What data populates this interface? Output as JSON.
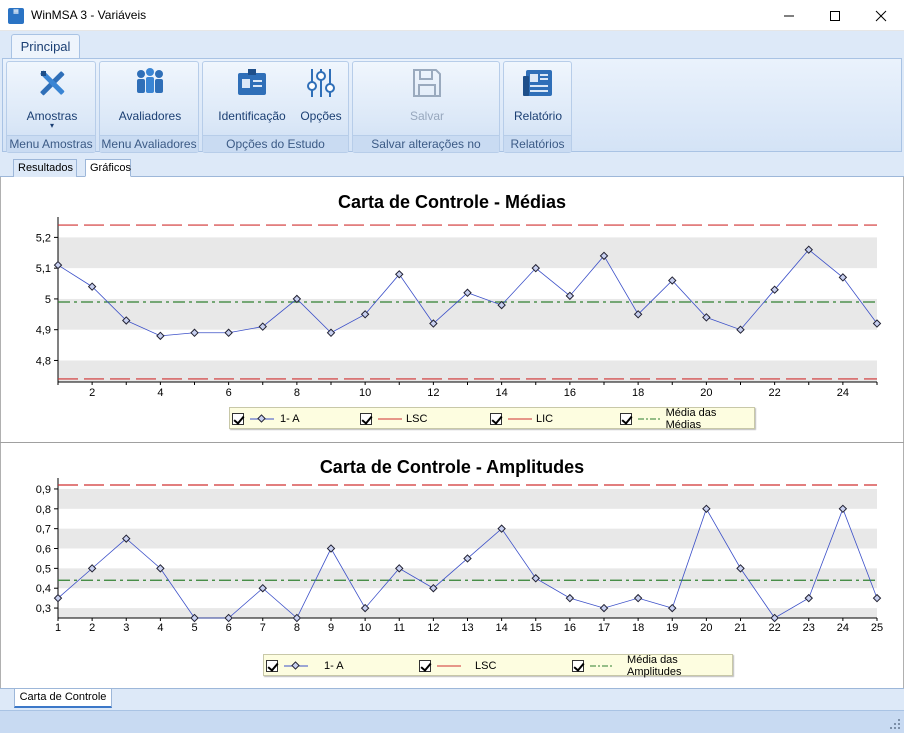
{
  "window": {
    "title": "WinMSA 3 - Variáveis",
    "icon": "app-icon"
  },
  "ribbon": {
    "tab": "Principal",
    "groups": [
      {
        "label": "Menu Amostras",
        "buttons": [
          {
            "label": "Amostras",
            "icon": "tools-icon"
          }
        ]
      },
      {
        "label": "Menu Avaliadores",
        "buttons": [
          {
            "label": "Avaliadores",
            "icon": "users-icon"
          }
        ]
      },
      {
        "label": "Opções do Estudo",
        "buttons": [
          {
            "label": "Identificação",
            "icon": "id-card-icon"
          },
          {
            "label": "Opções",
            "icon": "sliders-icon"
          }
        ]
      },
      {
        "label": "Salvar alterações no Estudo",
        "buttons": [
          {
            "label": "Salvar",
            "icon": "save-icon",
            "disabled": true
          }
        ]
      },
      {
        "label": "Relatórios",
        "buttons": [
          {
            "label": "Relatório",
            "icon": "report-icon"
          }
        ]
      }
    ]
  },
  "subtabs": {
    "results": "Resultados",
    "graphs": "Gráficos"
  },
  "bottom_tab": "Carta de Controle",
  "colors": {
    "series": "#3c50c8",
    "limit": "#d03030",
    "center": "#308030",
    "band": "#e8e8e8"
  },
  "chart_data": [
    {
      "type": "line",
      "title": "Carta de Controle - Médias",
      "x": [
        1,
        2,
        3,
        4,
        5,
        6,
        7,
        8,
        9,
        10,
        11,
        12,
        13,
        14,
        15,
        16,
        17,
        18,
        19,
        20,
        21,
        22,
        23,
        24,
        25
      ],
      "x_tick_labels": [
        "2",
        "4",
        "6",
        "8",
        "10",
        "12",
        "14",
        "16",
        "18",
        "20",
        "22",
        "24"
      ],
      "y_tick_labels": [
        "4,8",
        "4,9",
        "5",
        "5,1",
        "5,2"
      ],
      "ylim": [
        4.73,
        5.25
      ],
      "series": [
        {
          "name": "1- A",
          "values": [
            5.11,
            5.04,
            4.93,
            4.88,
            4.89,
            4.89,
            4.91,
            5.0,
            4.89,
            4.95,
            5.08,
            4.92,
            5.02,
            4.98,
            5.1,
            5.01,
            5.14,
            4.95,
            5.06,
            4.94,
            4.9,
            5.03,
            5.16,
            5.07,
            4.92
          ]
        }
      ],
      "lines": [
        {
          "name": "LSC",
          "value": 5.24,
          "style": "dashed"
        },
        {
          "name": "LIC",
          "value": 4.74,
          "style": "dashed"
        },
        {
          "name": "Média das Médias",
          "value": 4.99,
          "style": "dashdot"
        }
      ],
      "legend": [
        "1- A",
        "LSC",
        "LIC",
        "Média das Médias"
      ],
      "grid": "alternating horizontal bands"
    },
    {
      "type": "line",
      "title": "Carta de Controle - Amplitudes",
      "x": [
        1,
        2,
        3,
        4,
        5,
        6,
        7,
        8,
        9,
        10,
        11,
        12,
        13,
        14,
        15,
        16,
        17,
        18,
        19,
        20,
        21,
        22,
        23,
        24,
        25
      ],
      "x_tick_labels": [
        "1",
        "2",
        "3",
        "4",
        "5",
        "6",
        "7",
        "8",
        "9",
        "10",
        "11",
        "12",
        "13",
        "14",
        "15",
        "16",
        "17",
        "18",
        "19",
        "20",
        "21",
        "22",
        "23",
        "24",
        "25"
      ],
      "y_tick_labels": [
        "0,3",
        "0,4",
        "0,5",
        "0,6",
        "0,7",
        "0,8",
        "0,9"
      ],
      "ylim": [
        0.25,
        0.93
      ],
      "series": [
        {
          "name": "1- A",
          "values": [
            0.35,
            0.5,
            0.65,
            0.5,
            0.25,
            0.25,
            0.4,
            0.25,
            0.6,
            0.3,
            0.5,
            0.4,
            0.55,
            0.7,
            0.45,
            0.35,
            0.3,
            0.35,
            0.3,
            0.8,
            0.5,
            0.25,
            0.35,
            0.8,
            0.35
          ]
        }
      ],
      "lines": [
        {
          "name": "LSC",
          "value": 0.92,
          "style": "dashed"
        },
        {
          "name": "Média das Amplitudes",
          "value": 0.44,
          "style": "dashdot"
        }
      ],
      "legend": [
        "1- A",
        "LSC",
        "Média das Amplitudes"
      ],
      "grid": "alternating horizontal bands"
    }
  ]
}
